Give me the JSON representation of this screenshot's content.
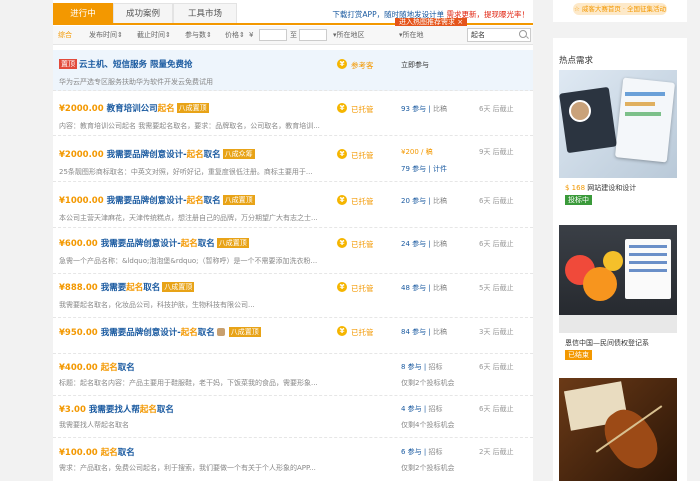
{
  "tabs": [
    "进行中",
    "成功案例",
    "工具市场"
  ],
  "notice": {
    "a": "下载打赏APP，随时随地发设计单",
    "b": "需求更新",
    "c": "，提现曝光率！"
  },
  "tip": "进入热图推荐需求",
  "filters": {
    "all": "综合",
    "pub_time": "发布时间",
    "deadline": "截止时间",
    "participants": "参与数",
    "price": "价格",
    "to": "至",
    "region": "所在地区",
    "location": "所在地",
    "search_value": "起名"
  },
  "listings": [
    {
      "price": "",
      "tag_top": "置顶",
      "title": "云主机、短信服务 限量免费抢",
      "kw": "",
      "title_tail": "",
      "tags": [],
      "desc": "华为云严选专区服务扶助华为软件开发云免费试用",
      "status": "参考客",
      "stat": "立即参与",
      "stat2": "",
      "time": ""
    },
    {
      "price": "¥2000.00",
      "tag_top": "",
      "title": "教育培训公司",
      "kw": "起名",
      "title_tail": "",
      "tags": [
        "八成置顶"
      ],
      "desc": "内容：教育培训公司起名 我需要起名取名，要求：品牌取名，公司取名，教育培训...",
      "status": "已托管",
      "stat": "93 参与",
      "stat_sep": "比稿",
      "stat2": "",
      "time": "6天 后截止"
    },
    {
      "price": "¥2000.00",
      "tag_top": "",
      "title": "我需要品牌创意设计-",
      "kw": "起名",
      "title_tail": "取名",
      "tags": [
        "八成众筹"
      ],
      "desc": "25条靓图形商标取名：中英文对照，好听好记，重复度很低注册。商标主要用于...",
      "status": "已托管",
      "stat": "¥200 / 稿",
      "stat_sep": "",
      "stat2": "79 参与 | 计件",
      "time": "9天 后截止"
    },
    {
      "price": "¥1000.00",
      "tag_top": "",
      "title": "我需要品牌创意设计-",
      "kw": "起名",
      "title_tail": "取名",
      "tags": [
        "八成置顶"
      ],
      "desc": "本公司主营天津麻花，天津传统糕点，想注册自己的品牌，万分期望广大有志之士...",
      "status": "已托管",
      "stat": "20 参与",
      "stat_sep": "比稿",
      "stat2": "",
      "time": "6天 后截止"
    },
    {
      "price": "¥600.00",
      "tag_top": "",
      "title": "我需要品牌创意设计-",
      "kw": "起名",
      "title_tail": "取名",
      "tags": [
        "八成置顶"
      ],
      "desc": "急需一个产品名称：&ldquo;泡泡堡&rdquo;（暂称呼）是一个不需要添加洗衣粉...",
      "status": "已托管",
      "stat": "24 参与",
      "stat_sep": "比稿",
      "stat2": "",
      "time": "6天 后截止"
    },
    {
      "price": "¥888.00",
      "tag_top": "",
      "title": "我需要",
      "kw": "起名",
      "title_tail": "取名",
      "tags": [
        "八成置顶"
      ],
      "desc": "我需要起名取名，化妆品公司，科技护肤，生物科技有限公司...",
      "status": "已托管",
      "stat": "48 参与",
      "stat_sep": "比稿",
      "stat2": "",
      "time": "5天 后截止"
    },
    {
      "price": "¥950.00",
      "tag_top": "",
      "title": "我需要品牌创意设计-",
      "kw": "起名",
      "title_tail": "取名",
      "tags": [
        "八成置顶"
      ],
      "desc": "",
      "status": "已托管",
      "stat": "84 参与",
      "stat_sep": "比稿",
      "stat2": "",
      "time": "3天 后截止"
    },
    {
      "price": "¥400.00",
      "tag_top": "",
      "title": "",
      "kw": "起名",
      "title_tail": "取名",
      "tags": [],
      "desc": "标题：起名取名内容：产品主要用于鞋服鞋，老干妈，下饭菜我的食品，需要形象...",
      "status": "",
      "stat": "8 参与",
      "stat_sep": "招标",
      "stat2": "仅剩2个投标机会",
      "time": "6天 后截止"
    },
    {
      "price": "¥3.00",
      "tag_top": "",
      "title": "我需要找人帮",
      "kw": "起名",
      "title_tail": "取名",
      "tags": [],
      "desc": "我需要找人帮起名取名",
      "status": "",
      "stat": "4 参与",
      "stat_sep": "招标",
      "stat2": "仅剩4个投标机会",
      "time": "6天 后截止"
    },
    {
      "price": "¥100.00",
      "tag_top": "",
      "title": "",
      "kw": "起名",
      "title_tail": "取名",
      "tags": [],
      "desc": "需求：产品取名，免费公司起名，利于搜索，我们要做一个有关于个人形象的APP...",
      "status": "",
      "stat": "6 参与",
      "stat_sep": "招标",
      "stat2": "仅剩2个投标机会",
      "time": "2天 后截止"
    }
  ],
  "sidebar": {
    "top_pill": "☆ 威客大赛首页 · 全国征集活动",
    "title": "热点需求",
    "cards": [
      {
        "price": "$ 168",
        "text": "网站建设和设计",
        "status": "投标中",
        "status_color": "#3a9a3a"
      },
      {
        "price": "",
        "text": "恩信中国—民间债权登记系",
        "status": "已结束",
        "status_color": "#f39800"
      }
    ]
  }
}
